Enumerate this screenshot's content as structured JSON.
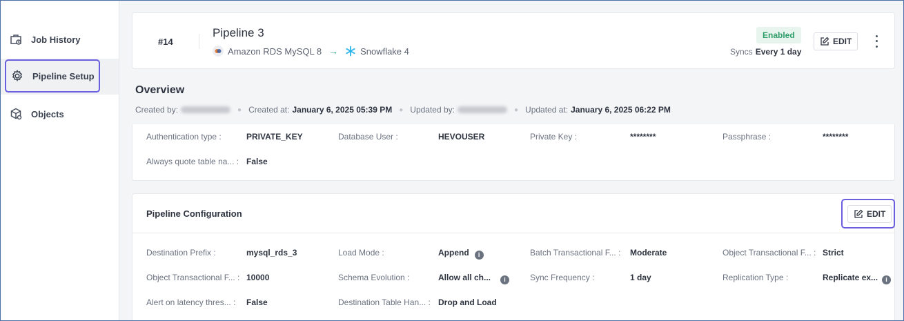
{
  "sidebar": {
    "items": [
      {
        "label": "Job History",
        "icon": "job-history-icon"
      },
      {
        "label": "Pipeline Setup",
        "icon": "gear-icon",
        "active": true
      },
      {
        "label": "Objects",
        "icon": "objects-icon"
      }
    ]
  },
  "header": {
    "number": "#14",
    "title": "Pipeline 3",
    "source": "Amazon RDS MySQL 8",
    "destination": "Snowflake 4",
    "status": "Enabled",
    "sync_label": "Syncs",
    "sync_value": "Every 1 day",
    "edit_label": "EDIT"
  },
  "overview": {
    "title": "Overview",
    "created_by_label": "Created by:",
    "created_at_label": "Created at:",
    "created_at": "January 6, 2025 05:39 PM",
    "updated_by_label": "Updated by:",
    "updated_at_label": "Updated at:",
    "updated_at": "January 6, 2025 06:22 PM"
  },
  "destination_fields": [
    {
      "label": "Authentication type :",
      "value": "PRIVATE_KEY"
    },
    {
      "label": "Database User :",
      "value": "HEVOUSER"
    },
    {
      "label": "Private Key :",
      "value": "********"
    },
    {
      "label": "Passphrase :",
      "value": "********"
    },
    {
      "label": "Always quote table na... :",
      "value": "False"
    }
  ],
  "config": {
    "title": "Pipeline Configuration",
    "edit_label": "EDIT",
    "fields": [
      {
        "label": "Destination Prefix :",
        "value": "mysql_rds_3"
      },
      {
        "label": "Load Mode :",
        "value": "Append"
      },
      {
        "label": "Batch Transactional F... :",
        "value": "Moderate"
      },
      {
        "label": "Object Transactional F... :",
        "value": "Strict"
      },
      {
        "label": "Object Transactional F... :",
        "value": "10000"
      },
      {
        "label": "Schema Evolution :",
        "value": "Allow all ch..."
      },
      {
        "label": "Sync Frequency :",
        "value": "1 day"
      },
      {
        "label": "Replication Type :",
        "value": "Replicate ex..."
      },
      {
        "label": "Alert on latency thres... :",
        "value": "False"
      },
      {
        "label": "Destination Table Han... :",
        "value": "Drop and Load"
      }
    ]
  },
  "colors": {
    "accent": "#6b5fe0",
    "enabled_text": "#2f9e6a",
    "enabled_bg": "#e7f5ee",
    "arrow": "#2aa987"
  }
}
